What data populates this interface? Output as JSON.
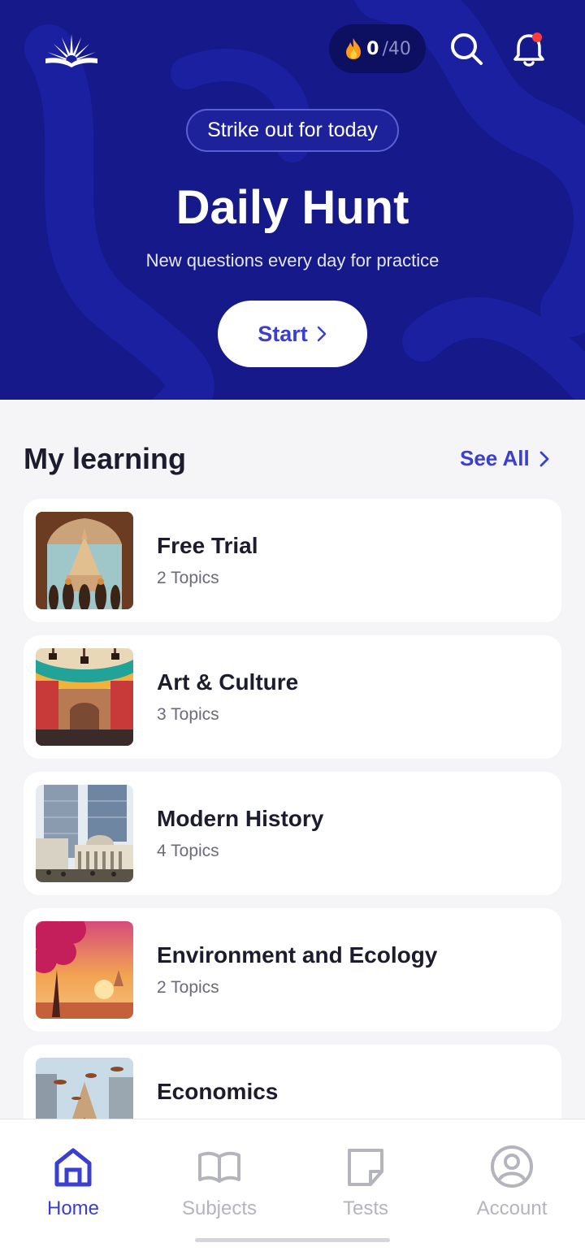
{
  "colors": {
    "hero_bg": "#15198a",
    "accent": "#3b3fd0",
    "inactive_nav": "#b4b4bc",
    "notification_dot": "#ff3b3b"
  },
  "header": {
    "logo_icon": "open-book-sunrise-icon",
    "streak": {
      "icon": "flame-icon",
      "current": "0",
      "total": "/40"
    },
    "search_icon": "search-icon",
    "bell_icon": "bell-icon",
    "has_notification": true
  },
  "hero": {
    "tag": "Strike out for today",
    "title": "Daily Hunt",
    "subtitle": "New questions every day for practice",
    "cta": "Start"
  },
  "my_learning": {
    "title": "My learning",
    "see_all": "See All",
    "items": [
      {
        "title": "Free Trial",
        "subtitle": "2 Topics"
      },
      {
        "title": "Art & Culture",
        "subtitle": "3 Topics"
      },
      {
        "title": "Modern History",
        "subtitle": "4 Topics"
      },
      {
        "title": "Environment and Ecology",
        "subtitle": "2 Topics"
      },
      {
        "title": "Economics",
        "subtitle": ""
      }
    ]
  },
  "bottom_nav": {
    "items": [
      {
        "label": "Home",
        "icon": "home-icon",
        "active": true
      },
      {
        "label": "Subjects",
        "icon": "book-icon",
        "active": false
      },
      {
        "label": "Tests",
        "icon": "note-icon",
        "active": false
      },
      {
        "label": "Account",
        "icon": "account-icon",
        "active": false
      }
    ]
  }
}
